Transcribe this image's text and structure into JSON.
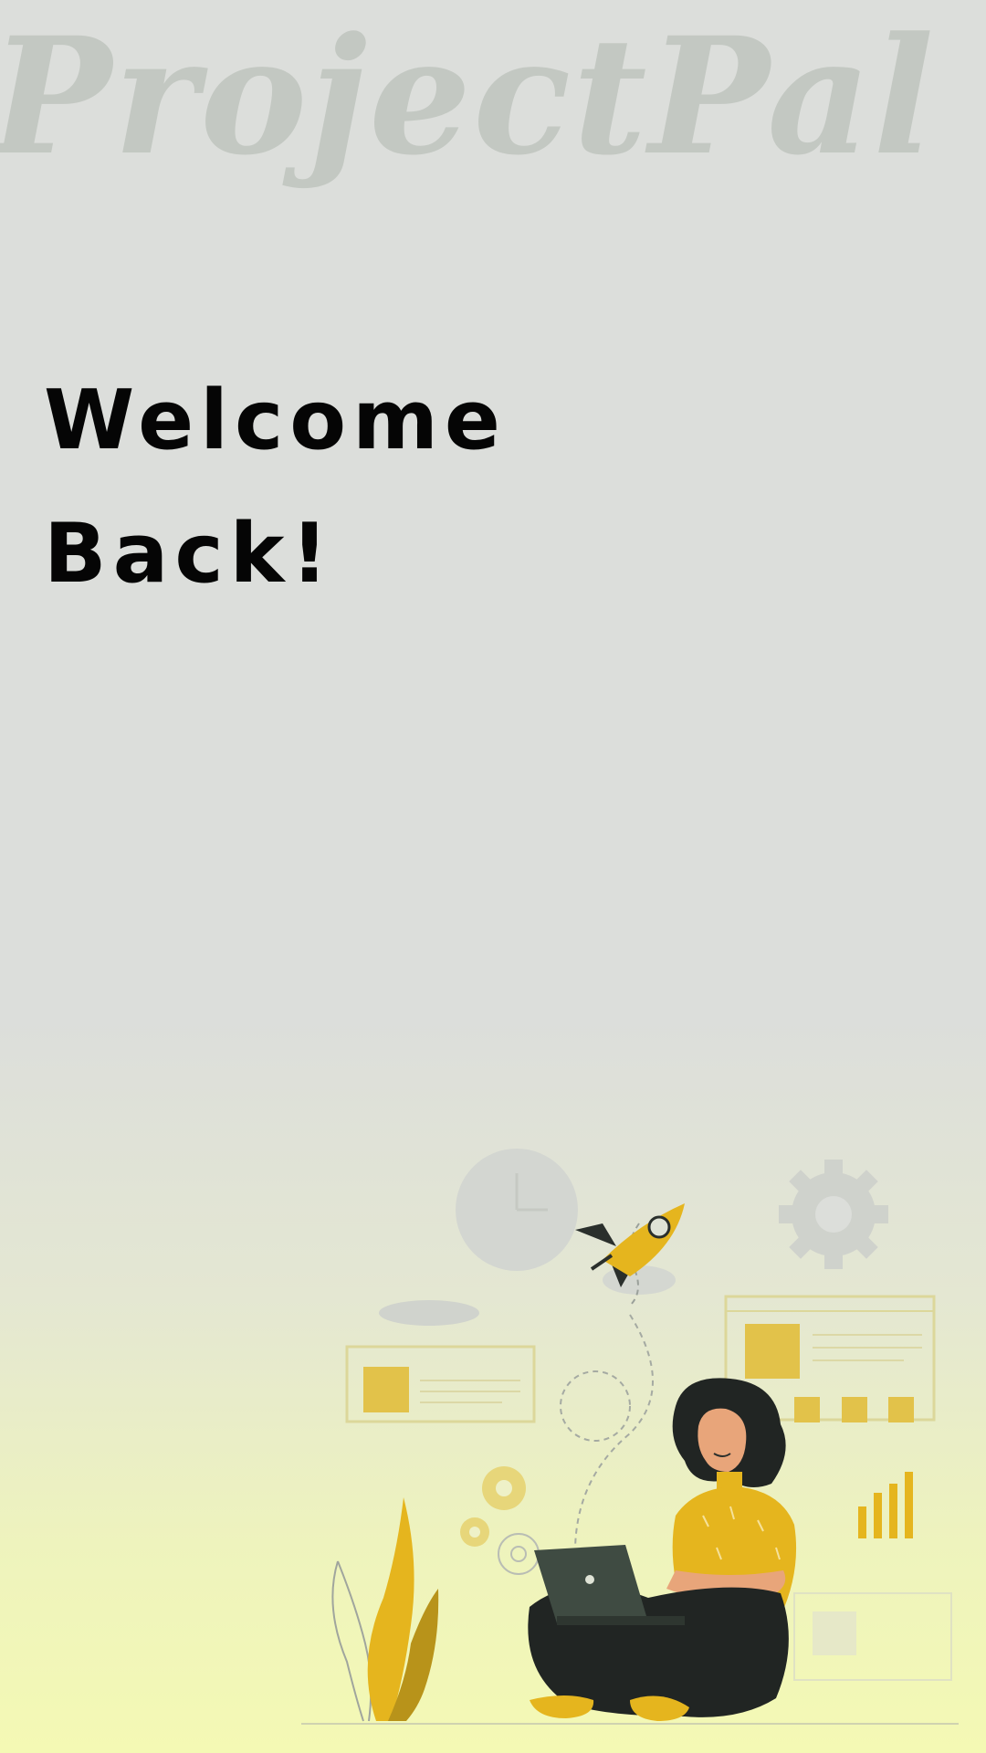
{
  "brand": {
    "logo_text": "ProjectPal"
  },
  "hero": {
    "line1": "Welcome",
    "line2": "Back!"
  },
  "illustration": {
    "icons": [
      "clock-icon",
      "rocket-icon",
      "gear-icon",
      "bar-chart-icon",
      "laptop-icon"
    ]
  },
  "colors": {
    "background_top": "#dcdedb",
    "background_bottom": "#f4f9b4",
    "accent": "#e5b51e",
    "text": "#050505",
    "watermark": "#c3c8c2"
  }
}
